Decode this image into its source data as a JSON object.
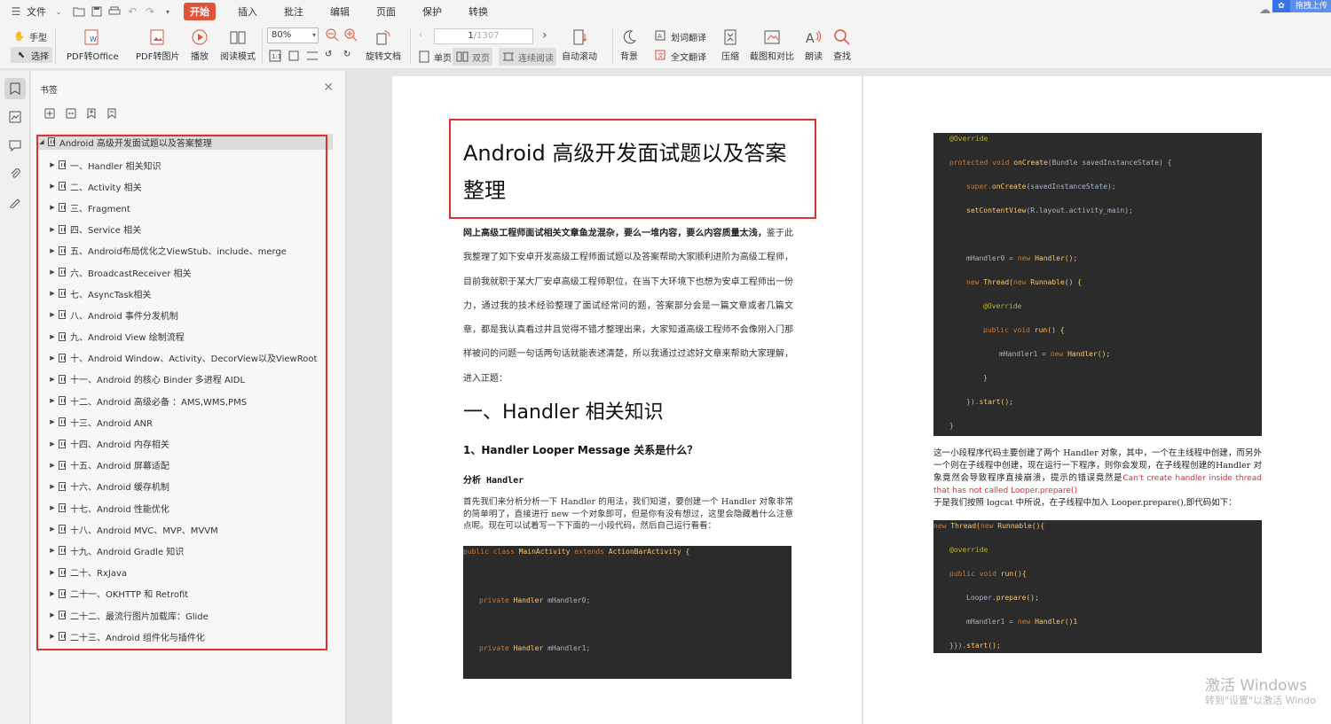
{
  "menubar": {
    "file_label": "文件",
    "tabs": [
      "开始",
      "插入",
      "批注",
      "编辑",
      "页面",
      "保护",
      "转换"
    ],
    "upload_label": "拖拽上传"
  },
  "toolbar": {
    "hand_label": "手型",
    "select_label": "选择",
    "pdf_to_office_label": "PDF转Office",
    "pdf_to_image_label": "PDF转图片",
    "play_label": "播放",
    "read_mode_label": "阅读模式",
    "zoom_value": "80%",
    "rotate_label": "旋转文档",
    "page_current": "1",
    "page_total": "/1307",
    "single_label": "单页",
    "double_label": "双页",
    "continuous_label": "连续阅读",
    "autoscroll_label": "自动滚动",
    "background_label": "背景",
    "word_translate_label": "划词翻译",
    "full_translate_label": "全文翻译",
    "compress_label": "压缩",
    "screenshot_label": "截图和对比",
    "read_aloud_label": "朗读",
    "find_label": "查找"
  },
  "panel": {
    "title": "书签",
    "root": "Android 高级开发面试题以及答案整理",
    "items": [
      "一、Handler 相关知识",
      "二、Activity 相关",
      "三、Fragment",
      "四、Service 相关",
      "五、Android布局优化之ViewStub、include、merge",
      "六、BroadcastReceiver 相关",
      "七、AsyncTask相关",
      "八、Android 事件分发机制",
      "九、Android View 绘制流程",
      "十、Android Window、Activity、DecorView以及ViewRoot",
      "十一、Android 的核心 Binder 多进程 AIDL",
      "十二、Android 高级必备 ：AMS,WMS,PMS",
      "十三、Android ANR",
      "十四、Android 内存相关",
      "十五、Android 屏幕适配",
      "十六、Android 缓存机制",
      "十七、Android 性能优化",
      "十八、Android MVC、MVP、MVVM",
      "十九、Android Gradle 知识",
      "二十、RxJava",
      "二十一、OKHTTP 和 Retrofit",
      "二十二、最流行图片加载库：Glide",
      "二十三、Android 组件化与插件化"
    ]
  },
  "page1": {
    "title_line1": "Android  高级开发面试题以及答案",
    "title_line2": "整理",
    "intro_bold": "网上高级工程师面试相关文章鱼龙混杂，要么一堆内容，要么内容质量太浅，",
    "intro_rest": "鉴于此我整理了如下安卓开发高级工程师面试题以及答案帮助大家顺利进阶为高级工程师，目前我就职于某大厂安卓高级工程师职位，在当下大环境下也想为安卓工程师出一份力，通过我的技术经验整理了面试经常问的题，答案部分会是一篇文章或者几篇文章，都是我认真看过并且觉得不错才整理出来，大家知道高级工程师不会像刚入门那样被问的问题一句话两句话就能表述清楚，所以我通过过滤好文章来帮助大家理解，进入正题：",
    "h1": "一、Handler  相关知识",
    "h2": "1、Handler Looper Message  关系是什么？",
    "h3": "分析 Handler",
    "para2": "首先我们来分析分析一下 Handler 的用法，我们知道，要创建一个 Handler 对象非常的简单明了，直接进行 new 一个对象即可，但是你有没有想过，这里会隐藏着什么注意点呢。现在可以试着写一下下面的一小段代码，然后自己运行看看：",
    "code": {
      "line1_kw": "public class ",
      "line1_cls": "MainActivity ",
      "line1_kw2": "extends ",
      "line1_cls2": "ActionBarActivity {",
      "line2_kw": "private ",
      "line2_type": "Handler ",
      "line2_var": "mHandler0;",
      "line3_kw": "private ",
      "line3_type": "Handler ",
      "line3_var": "mHandler1;"
    }
  },
  "page2": {
    "code1": {
      "l1": "@Override",
      "l2a": "protected void ",
      "l2b": "onCreate",
      "l2c": "(Bundle savedInstanceState) {",
      "l3a": "super.",
      "l3b": "onCreate",
      "l3c": "(savedInstanceState);",
      "l4a": "setContentView",
      "l4b": "(R.layout.activity_main);",
      "l5a": "mHandler0 = ",
      "l5b": "new ",
      "l5c": "Handler();",
      "l6a": "new ",
      "l6b": "Thread(",
      "l6c": "new ",
      "l6d": "Runnable() {",
      "l7": "@Override",
      "l8a": "public void ",
      "l8b": "run() {",
      "l9a": "mHandler1 = ",
      "l9b": "new ",
      "l9c": "Handler();",
      "l10": "}",
      "l11a": "}).",
      "l11b": "start();",
      "l12": "}"
    },
    "note_text": "这一小段程序代码主要创建了两个 Handler 对象，其中，一个在主线程中创建，而另外一个则在子线程中创建，现在运行一下程序，则你会发现，在子线程创建的Handler 对象竟然会导致程序直接崩溃，提示的错误竟然是",
    "note_red": "Can't create handler inside thread that has not called Looper.prepare()",
    "note_tail": "于是我们按照 logcat 中所说，在子线程中加入 Looper.prepare(),即代码如下：",
    "code2": {
      "l1a": "new ",
      "l1b": "Thread(",
      "l1c": "new ",
      "l1d": "Runnable(){",
      "l2": "@override",
      "l3a": "public void ",
      "l3b": "run(){",
      "l4a": "Looper.",
      "l4b": "prepare();",
      "l5a": "mHandler1 = ",
      "l5b": "new ",
      "l5c": "Handler()1",
      "l6a": "}}).",
      "l6b": "start();"
    }
  },
  "watermark": {
    "line1": "激活 Windows",
    "line2": "转到\"设置\"以激活 Windo"
  },
  "colors": {
    "accent_red": "#e03030",
    "active_tab": "#e0543a",
    "code_bg": "#2b2b2b"
  }
}
